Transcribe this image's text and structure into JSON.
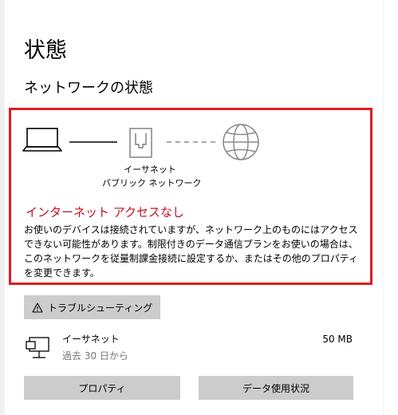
{
  "page": {
    "title": "状態",
    "section_title": "ネットワークの状態"
  },
  "diagram": {
    "adapter_name": "イーサネット",
    "network_type": "パブリック ネットワーク",
    "icons": [
      "laptop-icon",
      "ethernet-port-icon",
      "globe-icon"
    ]
  },
  "alert": {
    "title": "インターネット アクセスなし",
    "body": "お使いのデバイスは接続されていますが、ネットワーク上のものにはアクセスできない可能性があります。制限付きのデータ通信プランをお使いの場合は、このネットワークを従量制課金接続に設定するか、またはその他のプロパティを変更できます。",
    "color": "#c50f1f"
  },
  "troubleshoot": {
    "label": "トラブルシューティング",
    "icon": "warning-icon"
  },
  "connection": {
    "name": "イーサネット",
    "period": "過去 30 日から",
    "usage": "50 MB",
    "icon": "ethernet-adapter-icon"
  },
  "buttons": {
    "properties": "プロパティ",
    "data_usage": "データ使用状況"
  },
  "colors": {
    "highlight_border": "#e01b24",
    "button_bg": "#cccccc"
  }
}
